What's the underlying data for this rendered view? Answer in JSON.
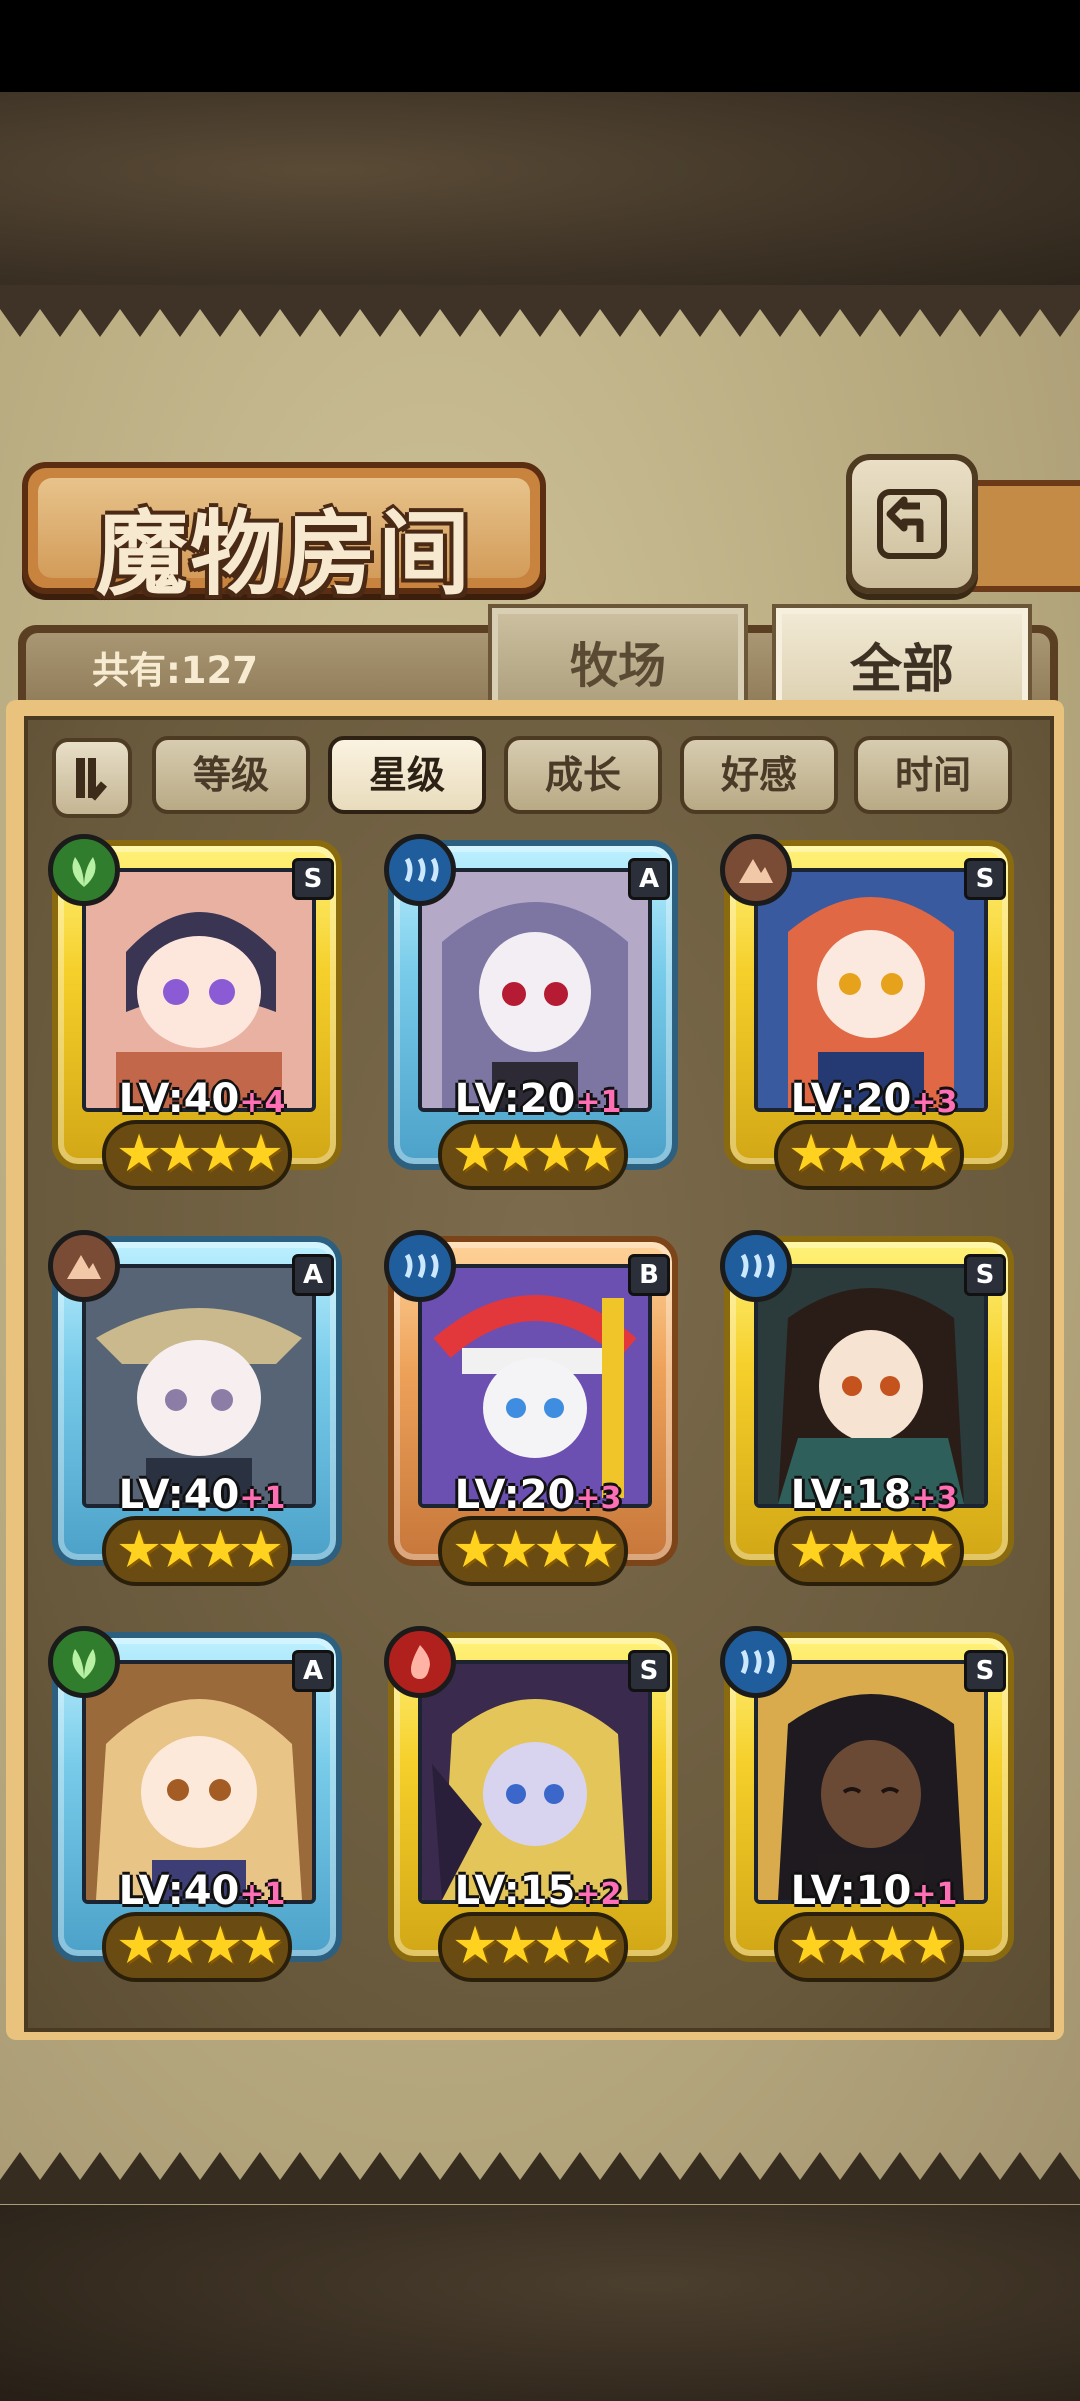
{
  "title": "魔物房间",
  "count_text": "共有:127",
  "tabs": [
    {
      "label": "牧场",
      "active": false
    },
    {
      "label": "全部",
      "active": true
    }
  ],
  "sort_buttons": [
    {
      "label": "等级",
      "active": false
    },
    {
      "label": "星级",
      "active": true
    },
    {
      "label": "成长",
      "active": false
    },
    {
      "label": "好感",
      "active": false
    },
    {
      "label": "时间",
      "active": false
    }
  ],
  "monsters": [
    {
      "element": "grass-icon",
      "rarity": "S",
      "level": "LV:40",
      "plus": "+4",
      "stars": 4
    },
    {
      "element": "water-icon",
      "rarity": "A",
      "level": "LV:20",
      "plus": "+1",
      "stars": 4
    },
    {
      "element": "earth-icon",
      "rarity": "S",
      "level": "LV:20",
      "plus": "+3",
      "stars": 4
    },
    {
      "element": "earth-icon",
      "rarity": "A",
      "level": "LV:40",
      "plus": "+1",
      "stars": 4
    },
    {
      "element": "water-icon",
      "rarity": "B",
      "level": "LV:20",
      "plus": "+3",
      "stars": 4
    },
    {
      "element": "water-icon",
      "rarity": "S",
      "level": "LV:18",
      "plus": "+3",
      "stars": 4
    },
    {
      "element": "grass-icon",
      "rarity": "A",
      "level": "LV:40",
      "plus": "+1",
      "stars": 4
    },
    {
      "element": "fire-icon",
      "rarity": "S",
      "level": "LV:15",
      "plus": "+2",
      "stars": 4
    },
    {
      "element": "water-icon",
      "rarity": "S",
      "level": "LV:10",
      "plus": "+1",
      "stars": 4
    }
  ],
  "colors": {
    "parchment": "#b9ab80",
    "frame": "#e9c27d",
    "panel": "#6a5a3d",
    "pink_plus": "#ff6fb5"
  }
}
